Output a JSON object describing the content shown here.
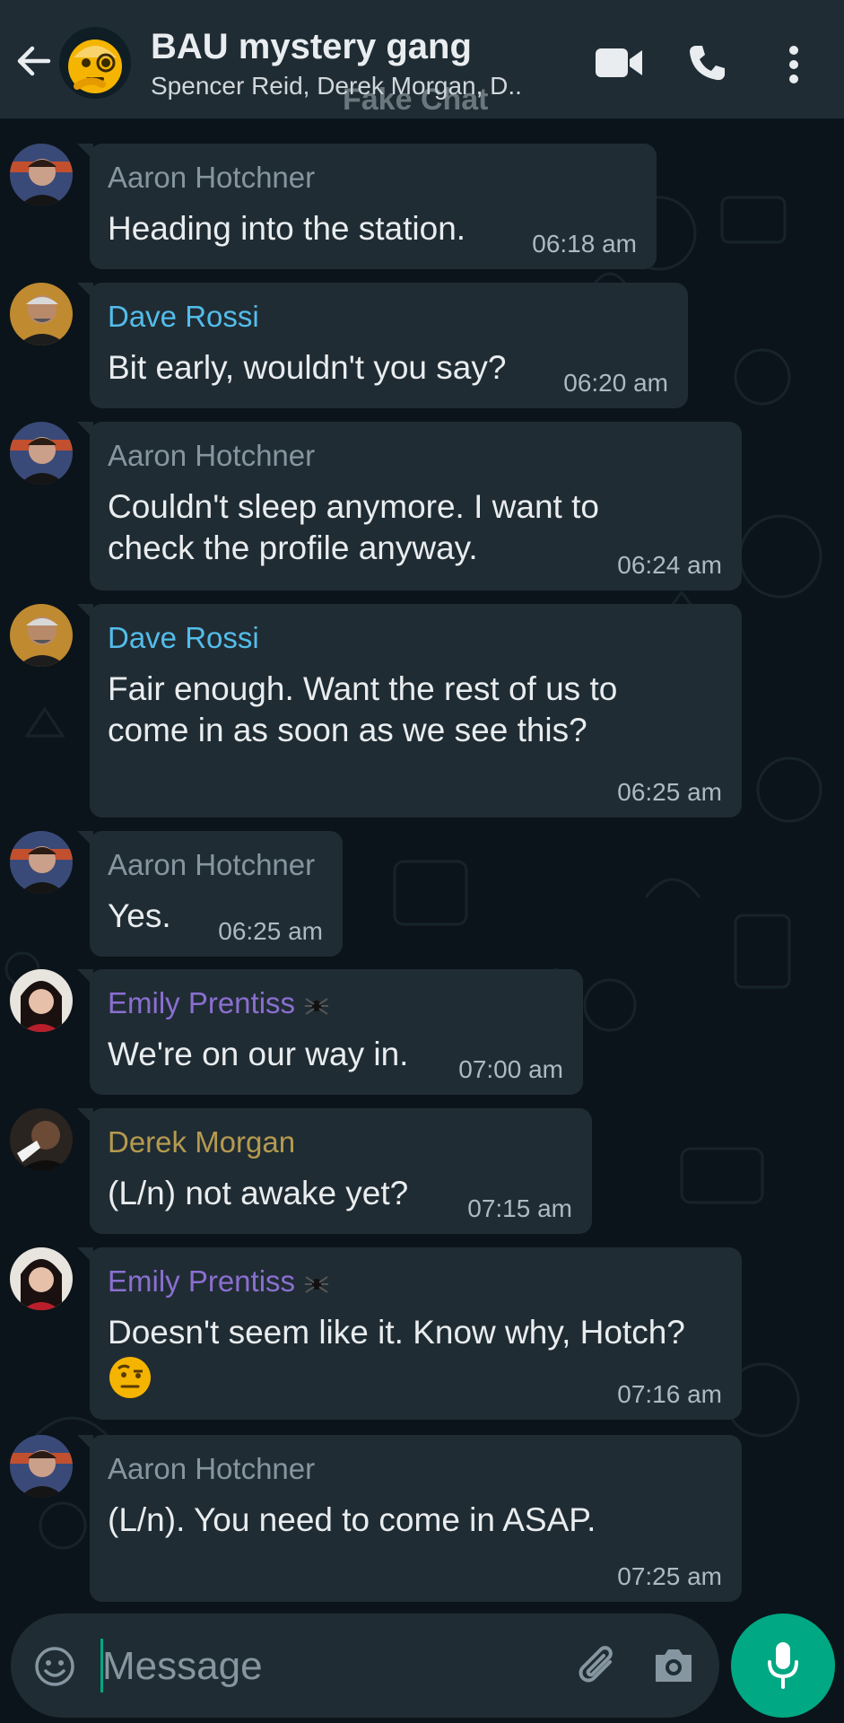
{
  "header": {
    "title": "BAU mystery gang",
    "subtitle": "Spencer Reid, Derek Morgan, D..",
    "watermark": "Fake Chat",
    "icons": [
      "back-arrow-icon",
      "group-avatar-emoji",
      "video-call-icon",
      "phone-icon",
      "more-options-icon"
    ]
  },
  "messages": [
    {
      "sender": "Aaron Hotchner",
      "sender_color": "#8696a0",
      "text": "Heading into the station.",
      "time": "06:18 am",
      "avatar": "hotchner"
    },
    {
      "sender": "Dave Rossi",
      "sender_color": "#53bdeb",
      "text": "Bit early, wouldn't you say?",
      "time": "06:20 am",
      "avatar": "rossi"
    },
    {
      "sender": "Aaron Hotchner",
      "sender_color": "#8696a0",
      "text": "Couldn't sleep anymore. I want to\ncheck the profile anyway.",
      "time": "06:24 am",
      "avatar": "hotchner"
    },
    {
      "sender": "Dave Rossi",
      "sender_color": "#53bdeb",
      "text": "Fair enough. Want the rest of us to\ncome in as soon as we see this?",
      "time": "06:25 am",
      "avatar": "rossi"
    },
    {
      "sender": "Aaron Hotchner",
      "sender_color": "#8696a0",
      "text": "Yes.",
      "time": "06:25 am",
      "avatar": "hotchner"
    },
    {
      "sender": "Emily Prentiss",
      "sender_color": "#8a6fd1",
      "text": "We're on our way in.",
      "time": "07:00 am",
      "avatar": "prentiss"
    },
    {
      "sender": "Derek Morgan",
      "sender_color": "#b59a4f",
      "text": "(L/n) not awake yet?",
      "time": "07:15 am",
      "avatar": "morgan"
    },
    {
      "sender": "Emily Prentiss",
      "sender_color": "#8a6fd1",
      "text": "Doesn't seem like it. Know why, Hotch?",
      "time": "07:16 am",
      "avatar": "prentiss",
      "emoji": "face-with-raised-eyebrow"
    },
    {
      "sender": "Aaron Hotchner",
      "sender_color": "#8696a0",
      "text": "(L/n). You need to come in ASAP.",
      "time": "07:25 am",
      "avatar": "hotchner"
    }
  ],
  "input": {
    "placeholder": "Message",
    "icons": [
      "emoji-icon",
      "attach-icon",
      "camera-icon",
      "mic-icon"
    ]
  },
  "colors": {
    "accent": "#00a884",
    "header_bg": "#1f2c34",
    "bubble_bg": "#202c33",
    "chat_bg": "#0b141a"
  }
}
